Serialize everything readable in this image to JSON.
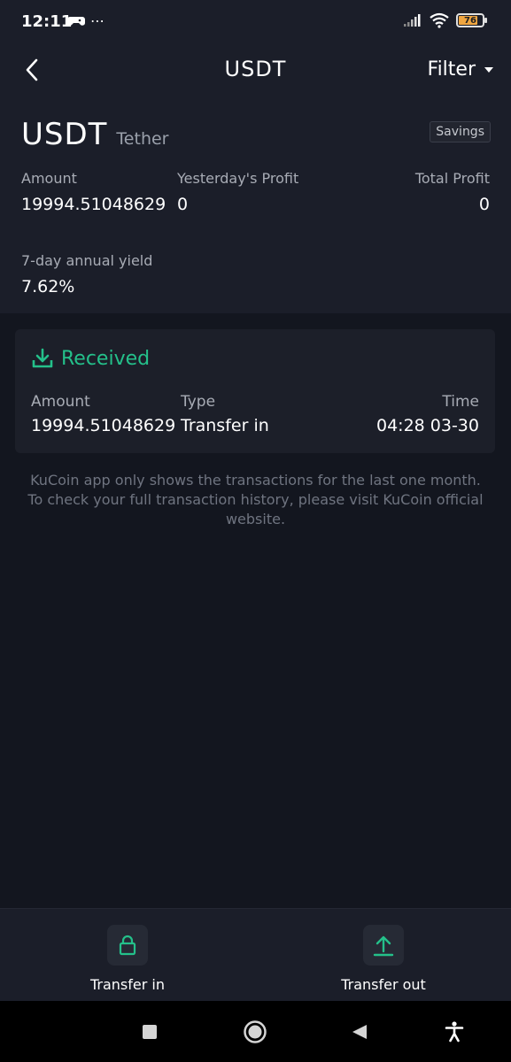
{
  "status_bar": {
    "time": "12:11",
    "extra_icons": "⋯",
    "battery_level": "76"
  },
  "header": {
    "title": "USDT",
    "filter_label": "Filter"
  },
  "summary": {
    "coin_symbol": "USDT",
    "coin_name": "Tether",
    "tag": "Savings",
    "amount_label": "Amount",
    "amount_value": "19994.51048629",
    "yesterday_label": "Yesterday's Profit",
    "yesterday_value": "0",
    "total_label": "Total Profit",
    "total_value": "0",
    "yield_label": "7-day annual yield",
    "yield_value": "7.62%"
  },
  "transaction": {
    "status": "Received",
    "amount_label": "Amount",
    "amount_value": "19994.51048629",
    "type_label": "Type",
    "type_value": "Transfer in",
    "time_label": "Time",
    "time_value": "04:28 03-30"
  },
  "notice": "KuCoin app only shows the transactions for the last one month. To check your full transaction history, please visit KuCoin official website.",
  "actions": {
    "transfer_in": "Transfer in",
    "transfer_out": "Transfer out"
  },
  "colors": {
    "accent": "#24c08a",
    "background": "#13161f",
    "card": "#1c1f29"
  }
}
